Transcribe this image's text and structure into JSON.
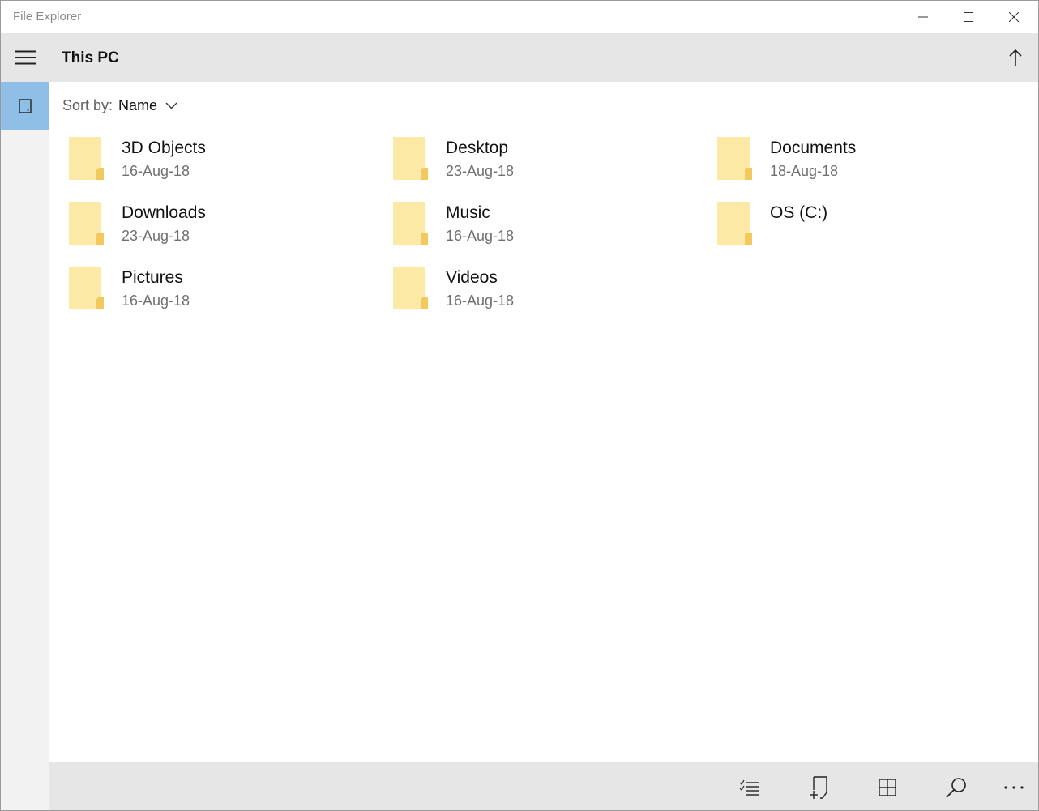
{
  "window": {
    "title": "File Explorer"
  },
  "header": {
    "title": "This PC"
  },
  "sort": {
    "label": "Sort by:",
    "value": "Name"
  },
  "items": [
    {
      "name": "3D Objects",
      "date": "16-Aug-18",
      "icon": "folder-icon"
    },
    {
      "name": "Desktop",
      "date": "23-Aug-18",
      "icon": "folder-icon"
    },
    {
      "name": "Documents",
      "date": "18-Aug-18",
      "icon": "folder-icon"
    },
    {
      "name": "Downloads",
      "date": "23-Aug-18",
      "icon": "folder-icon"
    },
    {
      "name": "Music",
      "date": "16-Aug-18",
      "icon": "folder-icon"
    },
    {
      "name": "OS (C:)",
      "date": "",
      "icon": "drive-icon"
    },
    {
      "name": "Pictures",
      "date": "16-Aug-18",
      "icon": "folder-icon"
    },
    {
      "name": "Videos",
      "date": "16-Aug-18",
      "icon": "folder-icon"
    }
  ],
  "colors": {
    "accent": "#8fbfe6",
    "chrome": "#e6e6e6",
    "rail": "#f2f2f2",
    "folder_light": "#fde9a6",
    "folder_dark": "#f2c95c"
  },
  "commands": [
    {
      "icon": "select-list-icon"
    },
    {
      "icon": "new-item-icon"
    },
    {
      "icon": "grid-view-icon"
    },
    {
      "icon": "search-icon"
    },
    {
      "icon": "more-icon"
    }
  ]
}
